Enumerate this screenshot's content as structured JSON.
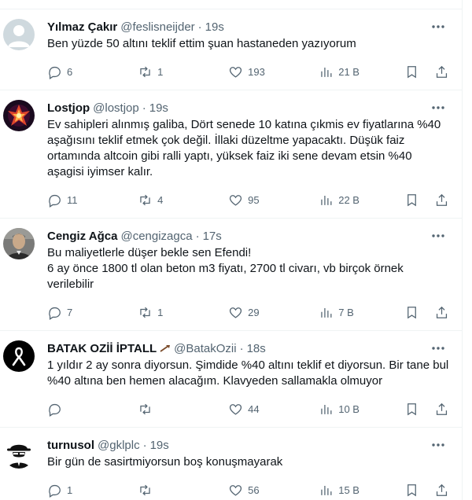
{
  "tweets": [
    {
      "name": "Yılmaz Çakır",
      "handle": "@feslisneijder",
      "sep": "·",
      "time": "19s",
      "text": "Ben yüzde 50 altını teklif ettim şuan hastaneden yazıyorum",
      "replies": "6",
      "retweets": "1",
      "likes": "193",
      "views": "21 B",
      "avatar": "default-avatar",
      "avatar_color": "#cfd9de"
    },
    {
      "name": "Lostjop",
      "handle": "@lostjop",
      "sep": "·",
      "time": "19s",
      "text": "Ev sahipleri alınmış galiba, Dört senede 10 katına çıkmis ev fiyatlarına %40 aşağısını teklif etmek çok değil. İllaki düzeltme yapacaktı. Düşük faiz ortamında altcoin gibi ralli yaptı, yüksek faiz iki sene devam etsin %40 aşagisi iyimser kalır.",
      "replies": "11",
      "retweets": "4",
      "likes": "95",
      "views": "22 B",
      "avatar": "phoenix-avatar",
      "avatar_color": "#1a0a1e"
    },
    {
      "name": "Cengiz Ağca",
      "handle": "@cengizagca",
      "sep": "·",
      "time": "17s",
      "text": "Bu maliyetlerle düşer bekle sen Efendi!\n6 ay önce 1800 tl olan beton m3 fiyatı, 2700 tl civarı, vb birçok örnek verilebilir",
      "replies": "7",
      "retweets": "1",
      "likes": "29",
      "views": "7 B",
      "avatar": "man-photo-avatar",
      "avatar_color": "#5a5a5a"
    },
    {
      "name": "BATAK OZİİ İPTALL",
      "handle": "@BatakOzii",
      "sep": "·",
      "time": "18s",
      "text": "1 yıldır 2 ay sonra diyorsun. Şimdide %40 altını teklif et diyorsun. Bir tane bul %40 altına ben hemen alacağım. Klavyeden sallamakla olmuyor",
      "replies": "",
      "retweets": "",
      "likes": "44",
      "views": "10 B",
      "avatar": "black-ribbon-avatar",
      "avatar_color": "#000000"
    },
    {
      "name": "turnusol",
      "handle": "@gklplc",
      "sep": "·",
      "time": "19s",
      "text": "Bir gün de sasirtmiyorsun boş konuşmayarak",
      "replies": "1",
      "retweets": "",
      "likes": "56",
      "views": "15 B",
      "avatar": "spy-avatar",
      "avatar_color": "#ffffff"
    }
  ]
}
